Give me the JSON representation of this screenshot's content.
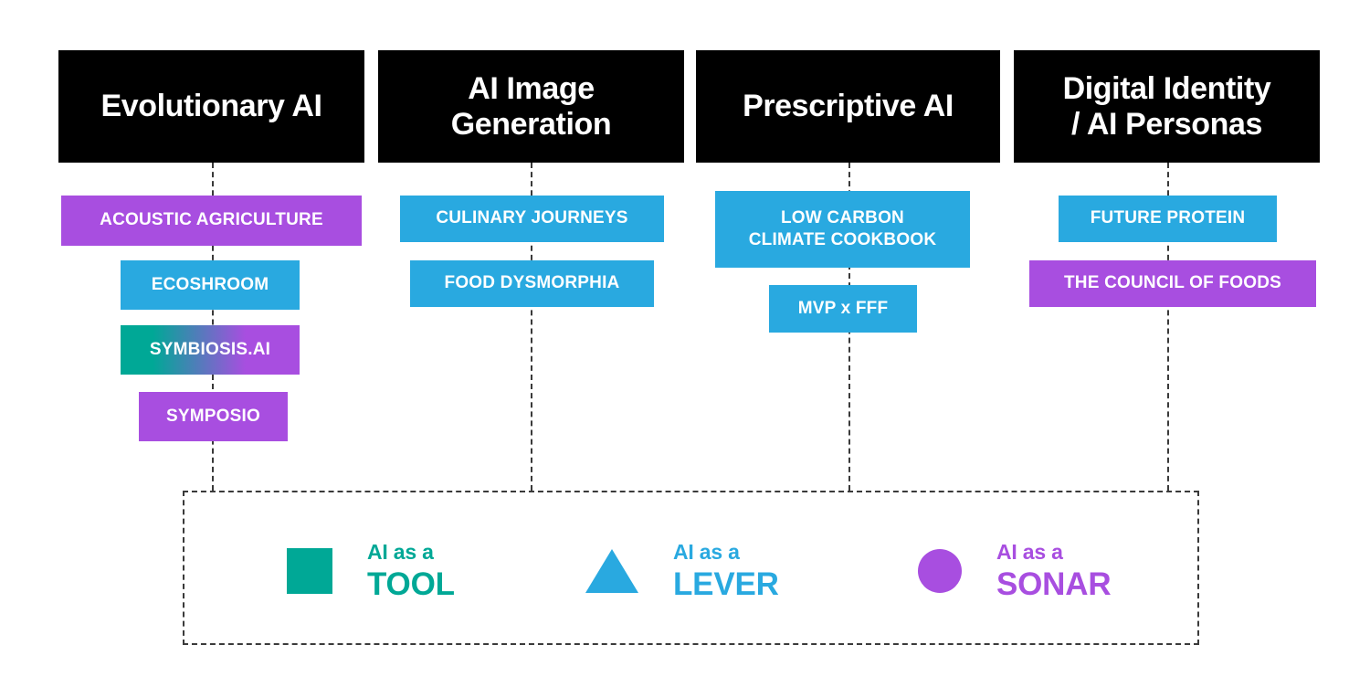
{
  "columns": [
    {
      "id": "evolutionary-ai",
      "title": "Evolutionary AI",
      "projects": [
        {
          "label": "ACOUSTIC  AGRICULTURE",
          "type": "sonar"
        },
        {
          "label": "ECOSHROOM",
          "type": "lever"
        },
        {
          "label": "SYMBIOSIS.AI",
          "type": "hybrid"
        },
        {
          "label": "SYMPOSIO",
          "type": "sonar"
        }
      ]
    },
    {
      "id": "ai-image-generation",
      "title": "AI Image\nGeneration",
      "title_line1": "AI Image",
      "title_line2": "Generation",
      "projects": [
        {
          "label": "CULINARY JOURNEYS",
          "type": "lever"
        },
        {
          "label": "FOOD DYSMORPHIA",
          "type": "lever"
        }
      ]
    },
    {
      "id": "prescriptive-ai",
      "title": "Prescriptive AI",
      "projects": [
        {
          "label": "LOW CARBON\nCLIMATE COOKBOOK",
          "line1": "LOW CARBON",
          "line2": "CLIMATE COOKBOOK",
          "type": "lever"
        },
        {
          "label": "MVP x FFF",
          "type": "lever"
        }
      ]
    },
    {
      "id": "digital-identity-ai-personas",
      "title": "Digital Identity\n/ AI Personas",
      "title_line1": "Digital Identity",
      "title_line2": "/ AI Personas",
      "projects": [
        {
          "label": "FUTURE PROTEIN",
          "type": "lever"
        },
        {
          "label": "THE COUNCIL OF FOODS",
          "type": "sonar"
        }
      ]
    }
  ],
  "legend": {
    "items": [
      {
        "glyph": "square",
        "prefix": "AI as a",
        "term": "TOOL",
        "color": "#00a896"
      },
      {
        "glyph": "triangle",
        "prefix": "AI as a",
        "term": "LEVER",
        "color": "#29a9e0"
      },
      {
        "glyph": "circle",
        "prefix": "AI as a",
        "term": "SONAR",
        "color": "#a84ee0"
      }
    ]
  },
  "colors": {
    "header_bg": "#000000",
    "header_text": "#ffffff",
    "tool_teal": "#00a896",
    "lever_blue": "#29a9e0",
    "sonar_purple": "#a84ee0",
    "connector": "#3a3a3a",
    "background": "#ffffff"
  }
}
